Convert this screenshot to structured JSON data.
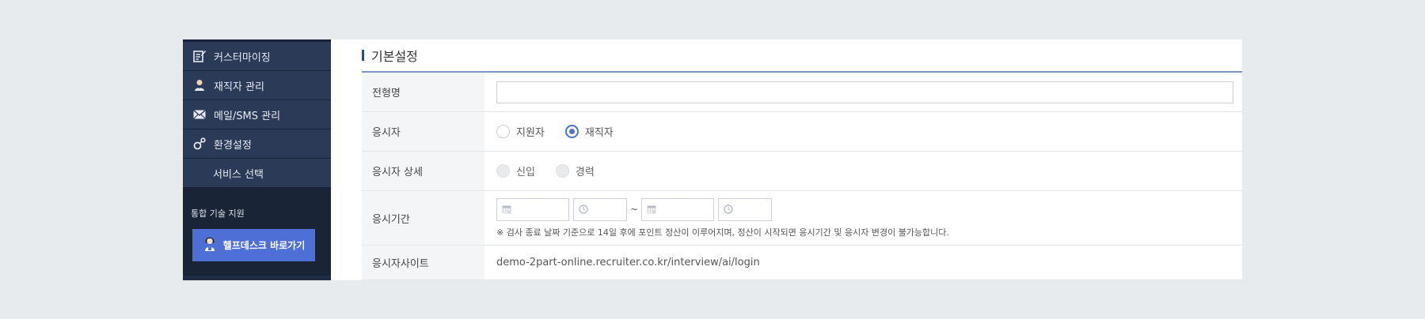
{
  "sidebar": {
    "items": [
      {
        "label": "커스터마이징",
        "icon": "edit-document-icon"
      },
      {
        "label": "재직자 관리",
        "icon": "person-icon"
      },
      {
        "label": "메일/SMS 관리",
        "icon": "mail-icon"
      },
      {
        "label": "환경설정",
        "icon": "settings-icon"
      },
      {
        "label": "서비스 선택",
        "icon": ""
      }
    ],
    "tech_label": "통합 기술 지원",
    "help_button": "헬프데스크 바로가기"
  },
  "section": {
    "title": "기본설정"
  },
  "form": {
    "name_label": "전형명",
    "name_value": "",
    "applicant_label": "응시자",
    "applicant_options": [
      "지원자",
      "재직자"
    ],
    "applicant_selected": "재직자",
    "detail_label": "응시자 상세",
    "detail_options": [
      "신입",
      "경력"
    ],
    "period_label": "응시기간",
    "period_separator": "~",
    "period_note": "※ 검사 종료 날짜 기준으로 14일 후에 포인트 정산이 이루어지며, 정산이 시작되면 응시기간 및 응시자 변경이 불가능합니다.",
    "site_label": "응시자사이트",
    "site_url": "demo-2part-online.recruiter.co.kr/interview/ai/login"
  },
  "colors": {
    "sidebar_bg": "#2b3a57",
    "accent": "#4d6fd6",
    "radio_checked": "#4a73cf"
  }
}
